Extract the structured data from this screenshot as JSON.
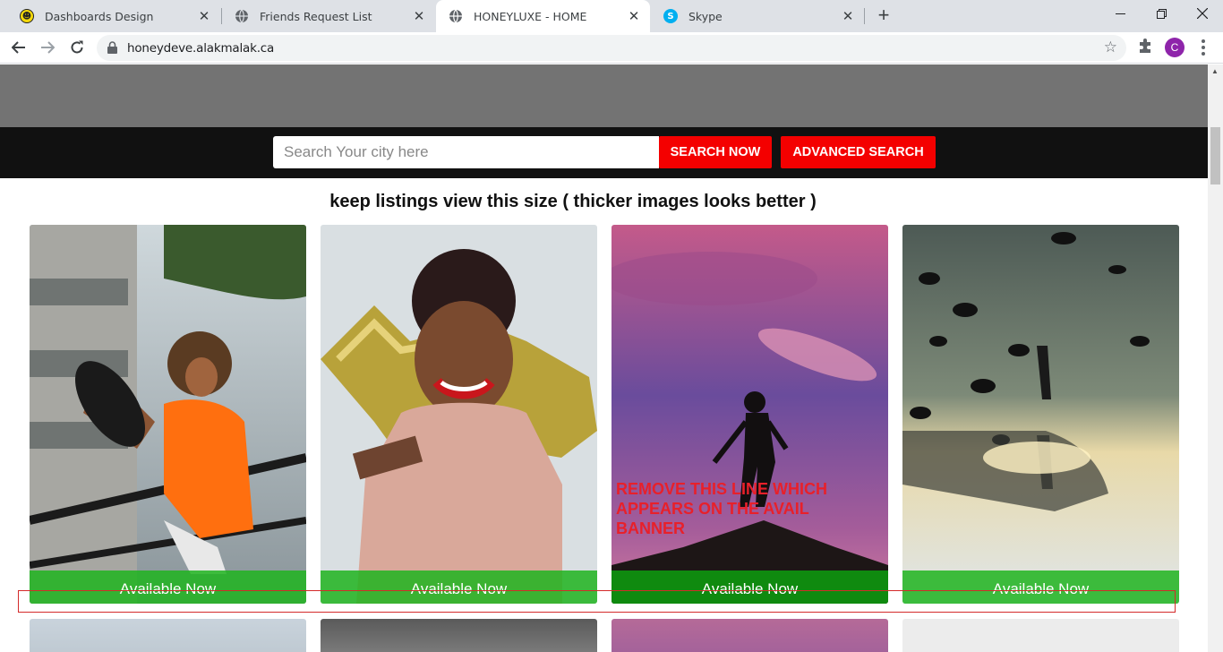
{
  "browser": {
    "tabs": [
      {
        "label": "Dashboards Design",
        "icon": "smiley-icon"
      },
      {
        "label": "Friends Request List",
        "icon": "globe-icon"
      },
      {
        "label": "HONEYLUXE - HOME",
        "icon": "globe-icon",
        "active": true
      },
      {
        "label": "Skype",
        "icon": "skype-icon"
      }
    ],
    "url": "honeydeve.alakmalak.ca",
    "profile_initial": "C"
  },
  "search": {
    "placeholder": "Search Your city here",
    "search_button": "SEARCH NOW",
    "advanced_button": "ADVANCED SEARCH"
  },
  "note": "keep listings view this size ( thicker images looks better )",
  "listings": [
    {
      "status": "Available Now"
    },
    {
      "status": "Available Now"
    },
    {
      "status": "Available Now",
      "overlay": "REMOVE THIS LINE WHICH APPEARS ON THE AVAIL BANNER"
    },
    {
      "status": "Available Now"
    }
  ],
  "colors": {
    "accent": "#f40000",
    "available": "#1eb41e",
    "annotation": "#e8202a"
  }
}
